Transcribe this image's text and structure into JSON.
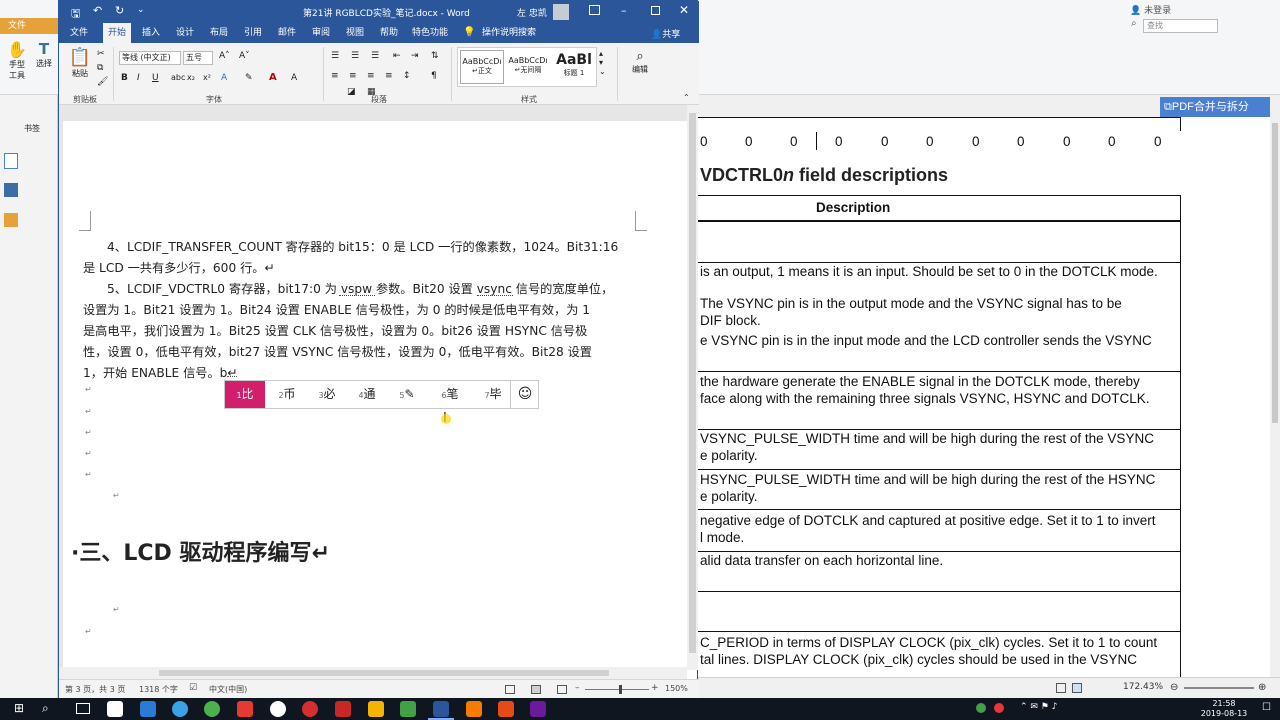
{
  "pdf": {
    "login": "未登录",
    "search_placeholder": "查找",
    "merge_button": "PDF合并与拆分",
    "left_tabs": [
      "手型工具",
      "选择",
      "工具"
    ],
    "bookmarks_label": "书签",
    "table_row_zeros": [
      "0",
      "0",
      "0",
      "0",
      "0",
      "0",
      "0",
      "0",
      "0",
      "0",
      "0"
    ],
    "section_title": "VDCTRL0",
    "section_title_italic": "n",
    "section_title_rest": " field descriptions",
    "table_header": "Description",
    "lines": [
      "is an output, 1 means it is an input. Should be set to 0 in the DOTCLK mode.",
      "The VSYNC pin is in the output mode and the VSYNC signal has to be",
      "DIF block.",
      "e VSYNC pin is in the input mode and the LCD controller sends the VSYNC",
      "the hardware generate the ENABLE signal in the DOTCLK mode, thereby",
      "face along with the remaining three signals VSYNC, HSYNC and DOTCLK.",
      "VSYNC_PULSE_WIDTH time and will be high during the rest of the VSYNC",
      "e polarity.",
      "HSYNC_PULSE_WIDTH time and will be high during the rest of the HSYNC",
      "e polarity.",
      "negative edge of DOTCLK and captured at positive edge. Set it to 1 to invert",
      "l mode.",
      "alid data transfer on each horizontal line.",
      "C_PERIOD in terms of DISPLAY CLOCK (pix_clk) cycles. Set it to 1 to count",
      "tal lines. DISPLAY CLOCK (pix_clk) cycles should be used in the VSYNC"
    ],
    "zoom": "172.43%"
  },
  "word": {
    "title": "第21讲 RGBLCD实验_笔记.docx - Word",
    "user": "左 忠凯",
    "tabs": [
      "文件",
      "开始",
      "插入",
      "设计",
      "布局",
      "引用",
      "邮件",
      "审阅",
      "视图",
      "帮助",
      "特色功能"
    ],
    "tell_me": "操作说明搜索",
    "share": "共享",
    "clipboard": {
      "paste": "粘贴",
      "label": "剪贴板"
    },
    "font": {
      "name": "等线 (中文正)",
      "size": "五号",
      "label": "字体"
    },
    "paragraph_label": "段落",
    "styles": {
      "label": "样式",
      "items": [
        {
          "preview": "AaBbCcDı",
          "name": "↵正文"
        },
        {
          "preview": "AaBbCcDı",
          "name": "↵无间隔"
        },
        {
          "preview": "AaBl",
          "name": "标题 1"
        }
      ]
    },
    "edit_label": "编辑",
    "doc": {
      "p4": [
        "4、LCDIF_TRANSFER_COUNT 寄存器的 bit15：0 是 LCD 一行的像素数，1024。Bit31:16",
        "是 LCD 一共有多少行，600 行。↵"
      ],
      "p5": [
        "5、LCDIF_VDCTRL0 寄存器，bit17:0 为 vspw 参数。Bit20 设置 vsync 信号的宽度单位，",
        "设置为 1。Bit21 设置为 1。Bit24 设置 ENABLE 信号极性，为 0 的时候是低电平有效，为 1",
        "是高电平，我们设置为 1。Bit25 设置 CLK 信号极性，设置为 0。bit26 设置 HSYNC 信号极",
        "性，设置 0，低电平有效，bit27 设置 VSYNC 信号极性，设置为 0，低电平有效。Bit28 设置",
        "1，开始 ENABLE 信号。b↵"
      ],
      "heading": "·三、LCD 驱动程序编写↵"
    },
    "ime": {
      "candidates": [
        {
          "num": "1",
          "text": "比"
        },
        {
          "num": "2",
          "text": "币"
        },
        {
          "num": "3",
          "text": "必"
        },
        {
          "num": "4",
          "text": "通"
        },
        {
          "num": "5",
          "text": "✎"
        },
        {
          "num": "6",
          "text": "笔"
        },
        {
          "num": "7",
          "text": "毕"
        }
      ],
      "emoji": "☺"
    },
    "status": {
      "page": "第 3 页，共 3 页",
      "words": "1318 个字",
      "lang": "中文(中国)",
      "zoom": "150%"
    }
  },
  "taskbar": {
    "time": "21:58",
    "date": "2019-08-13"
  }
}
